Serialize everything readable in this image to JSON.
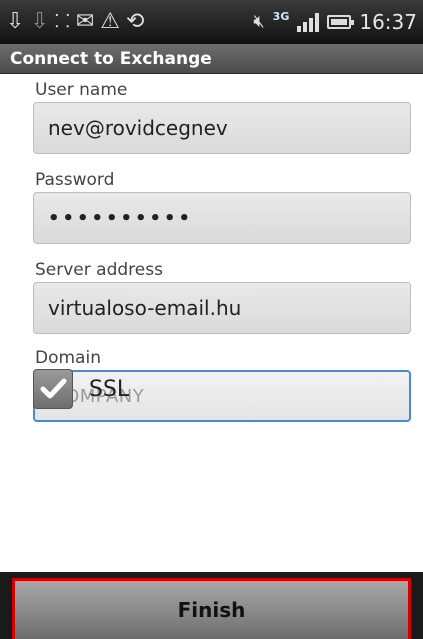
{
  "status_bar": {
    "time": "16:37",
    "network": "3G",
    "icons": [
      "download-icon",
      "download-icon",
      "wifi-icon",
      "mail-icon",
      "warning-icon",
      "sync-icon",
      "mute-icon",
      "signal-icon",
      "battery-icon"
    ]
  },
  "title_bar": {
    "title": "Connect to Exchange"
  },
  "form": {
    "username": {
      "label": "User name",
      "value": "nev@rovidcegnev"
    },
    "password": {
      "label": "Password",
      "masked_value": "••••••••••"
    },
    "server": {
      "label": "Server address",
      "value": "virtualoso-email.hu"
    },
    "domain": {
      "label": "Domain",
      "placeholder": "COMPANY"
    },
    "ssl": {
      "label": "SSL",
      "checked": true
    }
  },
  "actions": {
    "finish_label": "Finish"
  },
  "colors": {
    "focus_border": "#4a8ad0",
    "highlight_border": "#d40000"
  }
}
